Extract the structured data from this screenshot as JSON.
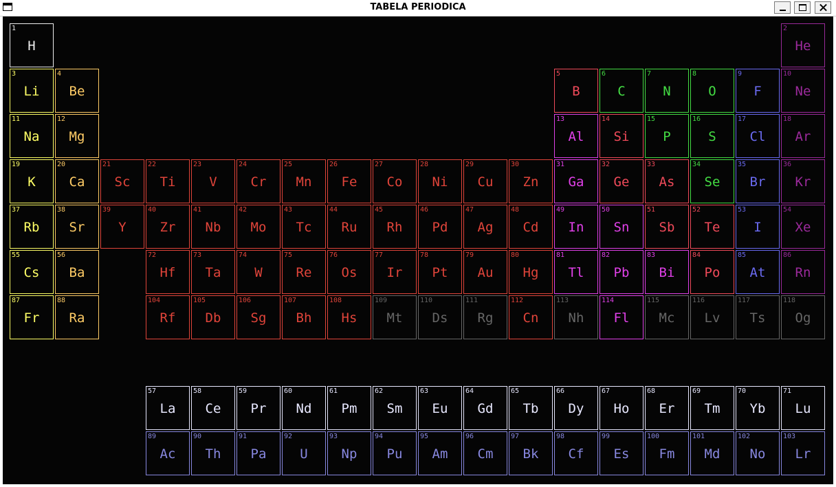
{
  "window": {
    "title": "TABELA PERIODICA",
    "minimize_icon": "minimize-icon",
    "maximize_icon": "maximize-icon",
    "close_icon": "close-icon"
  },
  "colors": {
    "alkali": "#ffff66",
    "alkaline": "#ffcc66",
    "transition": "#e0443a",
    "post_transition": "#e040e8",
    "metalloid": "#f04a5a",
    "nonmetal": "#44dd44",
    "halogen": "#6a6af0",
    "noble": "#9b2a9b",
    "unknown": "#666666",
    "lanthanide": "#e8e8ff",
    "actinide": "#8888e0",
    "hydrogen": "#f0f0f0"
  },
  "elements": [
    {
      "n": "1",
      "s": "H",
      "r": 1,
      "c": 1,
      "cat": "hydrogen"
    },
    {
      "n": "2",
      "s": "He",
      "r": 1,
      "c": 18,
      "cat": "noble"
    },
    {
      "n": "3",
      "s": "Li",
      "r": 2,
      "c": 1,
      "cat": "alkali"
    },
    {
      "n": "4",
      "s": "Be",
      "r": 2,
      "c": 2,
      "cat": "alkaline"
    },
    {
      "n": "5",
      "s": "B",
      "r": 2,
      "c": 13,
      "cat": "metalloid"
    },
    {
      "n": "6",
      "s": "C",
      "r": 2,
      "c": 14,
      "cat": "nonmetal"
    },
    {
      "n": "7",
      "s": "N",
      "r": 2,
      "c": 15,
      "cat": "nonmetal"
    },
    {
      "n": "8",
      "s": "O",
      "r": 2,
      "c": 16,
      "cat": "nonmetal"
    },
    {
      "n": "9",
      "s": "F",
      "r": 2,
      "c": 17,
      "cat": "halogen"
    },
    {
      "n": "10",
      "s": "Ne",
      "r": 2,
      "c": 18,
      "cat": "noble"
    },
    {
      "n": "11",
      "s": "Na",
      "r": 3,
      "c": 1,
      "cat": "alkali"
    },
    {
      "n": "12",
      "s": "Mg",
      "r": 3,
      "c": 2,
      "cat": "alkaline"
    },
    {
      "n": "13",
      "s": "Al",
      "r": 3,
      "c": 13,
      "cat": "post_transition"
    },
    {
      "n": "14",
      "s": "Si",
      "r": 3,
      "c": 14,
      "cat": "metalloid"
    },
    {
      "n": "15",
      "s": "P",
      "r": 3,
      "c": 15,
      "cat": "nonmetal"
    },
    {
      "n": "16",
      "s": "S",
      "r": 3,
      "c": 16,
      "cat": "nonmetal"
    },
    {
      "n": "17",
      "s": "Cl",
      "r": 3,
      "c": 17,
      "cat": "halogen"
    },
    {
      "n": "18",
      "s": "Ar",
      "r": 3,
      "c": 18,
      "cat": "noble"
    },
    {
      "n": "19",
      "s": "K",
      "r": 4,
      "c": 1,
      "cat": "alkali"
    },
    {
      "n": "20",
      "s": "Ca",
      "r": 4,
      "c": 2,
      "cat": "alkaline"
    },
    {
      "n": "21",
      "s": "Sc",
      "r": 4,
      "c": 3,
      "cat": "transition"
    },
    {
      "n": "22",
      "s": "Ti",
      "r": 4,
      "c": 4,
      "cat": "transition"
    },
    {
      "n": "23",
      "s": "V",
      "r": 4,
      "c": 5,
      "cat": "transition"
    },
    {
      "n": "24",
      "s": "Cr",
      "r": 4,
      "c": 6,
      "cat": "transition"
    },
    {
      "n": "25",
      "s": "Mn",
      "r": 4,
      "c": 7,
      "cat": "transition"
    },
    {
      "n": "26",
      "s": "Fe",
      "r": 4,
      "c": 8,
      "cat": "transition"
    },
    {
      "n": "27",
      "s": "Co",
      "r": 4,
      "c": 9,
      "cat": "transition"
    },
    {
      "n": "28",
      "s": "Ni",
      "r": 4,
      "c": 10,
      "cat": "transition"
    },
    {
      "n": "29",
      "s": "Cu",
      "r": 4,
      "c": 11,
      "cat": "transition"
    },
    {
      "n": "30",
      "s": "Zn",
      "r": 4,
      "c": 12,
      "cat": "transition"
    },
    {
      "n": "31",
      "s": "Ga",
      "r": 4,
      "c": 13,
      "cat": "post_transition"
    },
    {
      "n": "32",
      "s": "Ge",
      "r": 4,
      "c": 14,
      "cat": "metalloid"
    },
    {
      "n": "33",
      "s": "As",
      "r": 4,
      "c": 15,
      "cat": "metalloid"
    },
    {
      "n": "34",
      "s": "Se",
      "r": 4,
      "c": 16,
      "cat": "nonmetal"
    },
    {
      "n": "35",
      "s": "Br",
      "r": 4,
      "c": 17,
      "cat": "halogen"
    },
    {
      "n": "36",
      "s": "Kr",
      "r": 4,
      "c": 18,
      "cat": "noble"
    },
    {
      "n": "37",
      "s": "Rb",
      "r": 5,
      "c": 1,
      "cat": "alkali"
    },
    {
      "n": "38",
      "s": "Sr",
      "r": 5,
      "c": 2,
      "cat": "alkaline"
    },
    {
      "n": "39",
      "s": "Y",
      "r": 5,
      "c": 3,
      "cat": "transition"
    },
    {
      "n": "40",
      "s": "Zr",
      "r": 5,
      "c": 4,
      "cat": "transition"
    },
    {
      "n": "41",
      "s": "Nb",
      "r": 5,
      "c": 5,
      "cat": "transition"
    },
    {
      "n": "42",
      "s": "Mo",
      "r": 5,
      "c": 6,
      "cat": "transition"
    },
    {
      "n": "43",
      "s": "Tc",
      "r": 5,
      "c": 7,
      "cat": "transition"
    },
    {
      "n": "44",
      "s": "Ru",
      "r": 5,
      "c": 8,
      "cat": "transition"
    },
    {
      "n": "45",
      "s": "Rh",
      "r": 5,
      "c": 9,
      "cat": "transition"
    },
    {
      "n": "46",
      "s": "Pd",
      "r": 5,
      "c": 10,
      "cat": "transition"
    },
    {
      "n": "47",
      "s": "Ag",
      "r": 5,
      "c": 11,
      "cat": "transition"
    },
    {
      "n": "48",
      "s": "Cd",
      "r": 5,
      "c": 12,
      "cat": "transition"
    },
    {
      "n": "49",
      "s": "In",
      "r": 5,
      "c": 13,
      "cat": "post_transition"
    },
    {
      "n": "50",
      "s": "Sn",
      "r": 5,
      "c": 14,
      "cat": "post_transition"
    },
    {
      "n": "51",
      "s": "Sb",
      "r": 5,
      "c": 15,
      "cat": "metalloid"
    },
    {
      "n": "52",
      "s": "Te",
      "r": 5,
      "c": 16,
      "cat": "metalloid"
    },
    {
      "n": "53",
      "s": "I",
      "r": 5,
      "c": 17,
      "cat": "halogen"
    },
    {
      "n": "54",
      "s": "Xe",
      "r": 5,
      "c": 18,
      "cat": "noble"
    },
    {
      "n": "55",
      "s": "Cs",
      "r": 6,
      "c": 1,
      "cat": "alkali"
    },
    {
      "n": "56",
      "s": "Ba",
      "r": 6,
      "c": 2,
      "cat": "alkaline"
    },
    {
      "n": "72",
      "s": "Hf",
      "r": 6,
      "c": 4,
      "cat": "transition"
    },
    {
      "n": "73",
      "s": "Ta",
      "r": 6,
      "c": 5,
      "cat": "transition"
    },
    {
      "n": "74",
      "s": "W",
      "r": 6,
      "c": 6,
      "cat": "transition"
    },
    {
      "n": "75",
      "s": "Re",
      "r": 6,
      "c": 7,
      "cat": "transition"
    },
    {
      "n": "76",
      "s": "Os",
      "r": 6,
      "c": 8,
      "cat": "transition"
    },
    {
      "n": "77",
      "s": "Ir",
      "r": 6,
      "c": 9,
      "cat": "transition"
    },
    {
      "n": "78",
      "s": "Pt",
      "r": 6,
      "c": 10,
      "cat": "transition"
    },
    {
      "n": "79",
      "s": "Au",
      "r": 6,
      "c": 11,
      "cat": "transition"
    },
    {
      "n": "80",
      "s": "Hg",
      "r": 6,
      "c": 12,
      "cat": "transition"
    },
    {
      "n": "81",
      "s": "Tl",
      "r": 6,
      "c": 13,
      "cat": "post_transition"
    },
    {
      "n": "82",
      "s": "Pb",
      "r": 6,
      "c": 14,
      "cat": "post_transition"
    },
    {
      "n": "83",
      "s": "Bi",
      "r": 6,
      "c": 15,
      "cat": "post_transition"
    },
    {
      "n": "84",
      "s": "Po",
      "r": 6,
      "c": 16,
      "cat": "metalloid"
    },
    {
      "n": "85",
      "s": "At",
      "r": 6,
      "c": 17,
      "cat": "halogen"
    },
    {
      "n": "86",
      "s": "Rn",
      "r": 6,
      "c": 18,
      "cat": "noble"
    },
    {
      "n": "87",
      "s": "Fr",
      "r": 7,
      "c": 1,
      "cat": "alkali"
    },
    {
      "n": "88",
      "s": "Ra",
      "r": 7,
      "c": 2,
      "cat": "alkaline"
    },
    {
      "n": "104",
      "s": "Rf",
      "r": 7,
      "c": 4,
      "cat": "transition"
    },
    {
      "n": "105",
      "s": "Db",
      "r": 7,
      "c": 5,
      "cat": "transition"
    },
    {
      "n": "106",
      "s": "Sg",
      "r": 7,
      "c": 6,
      "cat": "transition"
    },
    {
      "n": "107",
      "s": "Bh",
      "r": 7,
      "c": 7,
      "cat": "transition"
    },
    {
      "n": "108",
      "s": "Hs",
      "r": 7,
      "c": 8,
      "cat": "transition"
    },
    {
      "n": "109",
      "s": "Mt",
      "r": 7,
      "c": 9,
      "cat": "unknown"
    },
    {
      "n": "110",
      "s": "Ds",
      "r": 7,
      "c": 10,
      "cat": "unknown"
    },
    {
      "n": "111",
      "s": "Rg",
      "r": 7,
      "c": 11,
      "cat": "unknown"
    },
    {
      "n": "112",
      "s": "Cn",
      "r": 7,
      "c": 12,
      "cat": "transition"
    },
    {
      "n": "113",
      "s": "Nh",
      "r": 7,
      "c": 13,
      "cat": "unknown"
    },
    {
      "n": "114",
      "s": "Fl",
      "r": 7,
      "c": 14,
      "cat": "post_transition"
    },
    {
      "n": "115",
      "s": "Mc",
      "r": 7,
      "c": 15,
      "cat": "unknown"
    },
    {
      "n": "116",
      "s": "Lv",
      "r": 7,
      "c": 16,
      "cat": "unknown"
    },
    {
      "n": "117",
      "s": "Ts",
      "r": 7,
      "c": 17,
      "cat": "unknown"
    },
    {
      "n": "118",
      "s": "Og",
      "r": 7,
      "c": 18,
      "cat": "unknown"
    },
    {
      "n": "57",
      "s": "La",
      "r": 9,
      "c": 4,
      "cat": "lanthanide"
    },
    {
      "n": "58",
      "s": "Ce",
      "r": 9,
      "c": 5,
      "cat": "lanthanide"
    },
    {
      "n": "59",
      "s": "Pr",
      "r": 9,
      "c": 6,
      "cat": "lanthanide"
    },
    {
      "n": "60",
      "s": "Nd",
      "r": 9,
      "c": 7,
      "cat": "lanthanide"
    },
    {
      "n": "61",
      "s": "Pm",
      "r": 9,
      "c": 8,
      "cat": "lanthanide"
    },
    {
      "n": "62",
      "s": "Sm",
      "r": 9,
      "c": 9,
      "cat": "lanthanide"
    },
    {
      "n": "63",
      "s": "Eu",
      "r": 9,
      "c": 10,
      "cat": "lanthanide"
    },
    {
      "n": "64",
      "s": "Gd",
      "r": 9,
      "c": 11,
      "cat": "lanthanide"
    },
    {
      "n": "65",
      "s": "Tb",
      "r": 9,
      "c": 12,
      "cat": "lanthanide"
    },
    {
      "n": "66",
      "s": "Dy",
      "r": 9,
      "c": 13,
      "cat": "lanthanide"
    },
    {
      "n": "67",
      "s": "Ho",
      "r": 9,
      "c": 14,
      "cat": "lanthanide"
    },
    {
      "n": "68",
      "s": "Er",
      "r": 9,
      "c": 15,
      "cat": "lanthanide"
    },
    {
      "n": "69",
      "s": "Tm",
      "r": 9,
      "c": 16,
      "cat": "lanthanide"
    },
    {
      "n": "70",
      "s": "Yb",
      "r": 9,
      "c": 17,
      "cat": "lanthanide"
    },
    {
      "n": "71",
      "s": "Lu",
      "r": 9,
      "c": 18,
      "cat": "lanthanide"
    },
    {
      "n": "89",
      "s": "Ac",
      "r": 10,
      "c": 4,
      "cat": "actinide"
    },
    {
      "n": "90",
      "s": "Th",
      "r": 10,
      "c": 5,
      "cat": "actinide"
    },
    {
      "n": "91",
      "s": "Pa",
      "r": 10,
      "c": 6,
      "cat": "actinide"
    },
    {
      "n": "92",
      "s": "U",
      "r": 10,
      "c": 7,
      "cat": "actinide"
    },
    {
      "n": "93",
      "s": "Np",
      "r": 10,
      "c": 8,
      "cat": "actinide"
    },
    {
      "n": "94",
      "s": "Pu",
      "r": 10,
      "c": 9,
      "cat": "actinide"
    },
    {
      "n": "95",
      "s": "Am",
      "r": 10,
      "c": 10,
      "cat": "actinide"
    },
    {
      "n": "96",
      "s": "Cm",
      "r": 10,
      "c": 11,
      "cat": "actinide"
    },
    {
      "n": "97",
      "s": "Bk",
      "r": 10,
      "c": 12,
      "cat": "actinide"
    },
    {
      "n": "98",
      "s": "Cf",
      "r": 10,
      "c": 13,
      "cat": "actinide"
    },
    {
      "n": "99",
      "s": "Es",
      "r": 10,
      "c": 14,
      "cat": "actinide"
    },
    {
      "n": "100",
      "s": "Fm",
      "r": 10,
      "c": 15,
      "cat": "actinide"
    },
    {
      "n": "101",
      "s": "Md",
      "r": 10,
      "c": 16,
      "cat": "actinide"
    },
    {
      "n": "102",
      "s": "No",
      "r": 10,
      "c": 17,
      "cat": "actinide"
    },
    {
      "n": "103",
      "s": "Lr",
      "r": 10,
      "c": 18,
      "cat": "actinide"
    }
  ]
}
